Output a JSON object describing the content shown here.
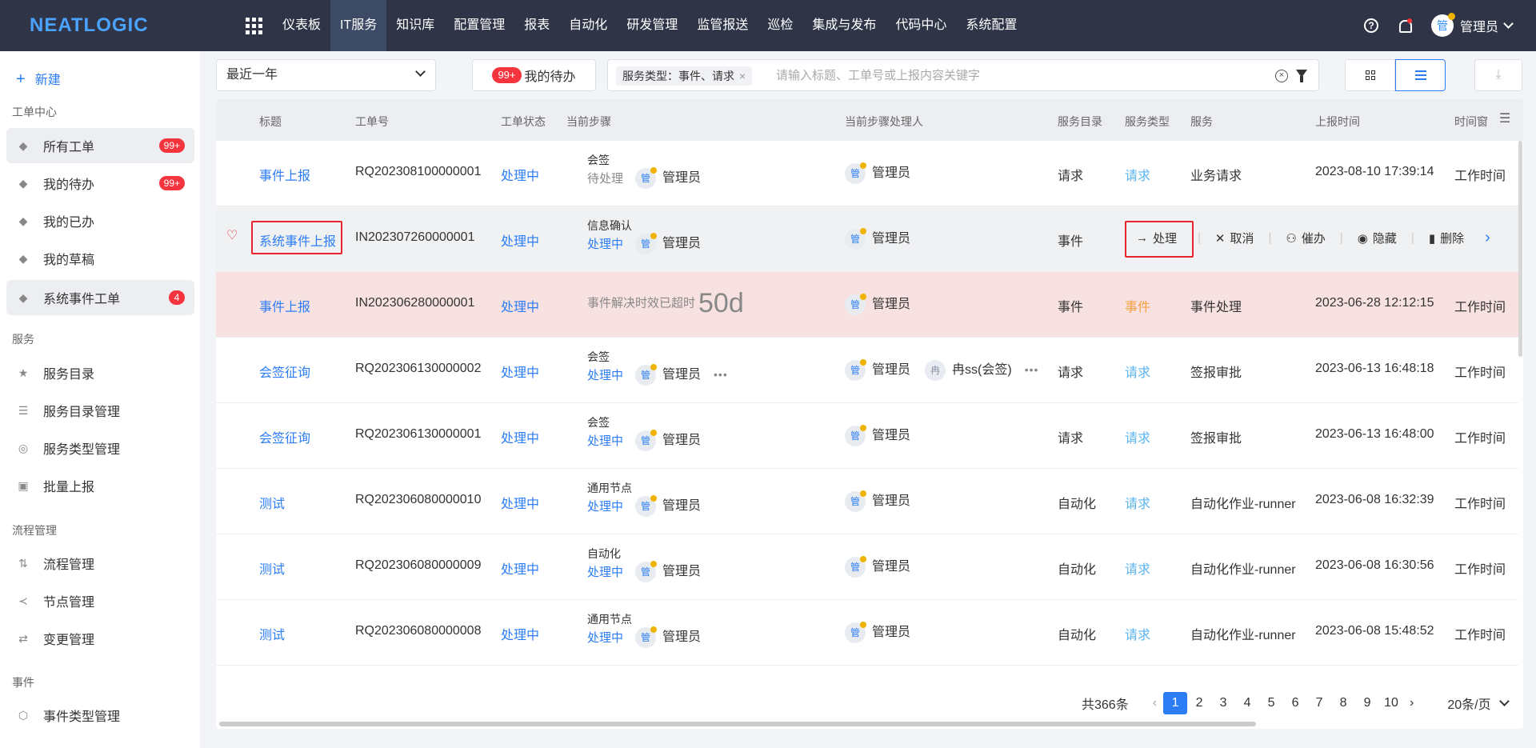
{
  "topbar": {
    "logo": "NEATLOGIC",
    "nav": [
      "仪表板",
      "IT服务",
      "知识库",
      "配置管理",
      "报表",
      "自动化",
      "研发管理",
      "监管报送",
      "巡检",
      "集成与发布",
      "代码中心",
      "系统配置"
    ],
    "active_nav": "IT服务",
    "help_glyph": "?",
    "user_avatar": "管",
    "user_name": "管理员"
  },
  "sidebar": {
    "new_label": "新建",
    "new_glyph": "+",
    "sections": [
      "工单中心",
      "服务",
      "流程管理",
      "事件"
    ],
    "workorder_items": [
      {
        "label": "所有工单",
        "badge": "99+"
      },
      {
        "label": "我的待办",
        "badge": "99+"
      },
      {
        "label": "我的已办"
      },
      {
        "label": "我的草稿"
      },
      {
        "label": "系统事件工单",
        "badge": "4"
      }
    ],
    "service_items": [
      "服务目录",
      "服务目录管理",
      "服务类型管理",
      "批量上报"
    ],
    "process_items": [
      "流程管理",
      "节点管理",
      "变更管理"
    ],
    "event_items": [
      "事件类型管理"
    ],
    "icon_glyphs": {
      "tag": "◆",
      "star": "★",
      "list": "☰",
      "type": "◎",
      "batch": "▣",
      "flow": "⇅",
      "node": "≺",
      "change": "⇄",
      "event": "⬡"
    }
  },
  "filters": {
    "range": "最近一年",
    "todo_badge": "99+",
    "todo_label": "我的待办",
    "tag_label": "服务类型：事件、请求",
    "tag_close": "×",
    "clear_glyph": "×",
    "search_placeholder": "请输入标题、工单号或上报内容关键字",
    "download_glyph": "⤓"
  },
  "table": {
    "columns": [
      "标题",
      "工单号",
      "工单状态",
      "当前步骤",
      "当前步骤处理人",
      "服务目录",
      "服务类型",
      "服务",
      "上报时间",
      "时间窗"
    ],
    "columns_glyph": "☰",
    "rows": [
      {
        "title": "事件上报",
        "no": "RQ202308100000001",
        "status": "处理中",
        "step_name": "会签",
        "step_status": "待处理",
        "step_avatar": "管",
        "step_user": "管理员",
        "handler_avatar": "管",
        "handler": "管理员",
        "catalog": "请求",
        "type": "请求",
        "service": "业务请求",
        "time": "2023-08-10 17:39:14",
        "window": "工作时间"
      },
      {
        "title": "系统事件上报",
        "no": "IN202307260000001",
        "status": "处理中",
        "step_name": "信息确认",
        "step_status": "处理中",
        "step_avatar": "管",
        "step_user": "管理员",
        "handler_avatar": "管",
        "handler": "管理员",
        "catalog": "事件"
      },
      {
        "title": "事件上报",
        "no": "IN202306280000001",
        "status": "处理中",
        "overtime_text": "事件解决时效已超时",
        "overtime_value": "50d",
        "handler_avatar": "管",
        "handler": "管理员",
        "catalog": "事件",
        "type": "事件",
        "service": "事件处理",
        "time": "2023-06-28 12:12:15",
        "window": "工作时间"
      },
      {
        "title": "会签征询",
        "no": "RQ202306130000002",
        "status": "处理中",
        "step_name": "会签",
        "step_status": "处理中",
        "step_avatar": "管",
        "step_user": "管理员",
        "more": "•••",
        "handler_avatar": "管",
        "handler": "管理员",
        "handler2_avatar": "冉",
        "handler2": "冉ss(会签)",
        "handler_more": "•••",
        "catalog": "请求",
        "type": "请求",
        "service": "签报审批",
        "time": "2023-06-13 16:48:18",
        "window": "工作时间"
      },
      {
        "title": "会签征询",
        "no": "RQ202306130000001",
        "status": "处理中",
        "step_name": "会签",
        "step_status": "处理中",
        "step_avatar": "管",
        "step_user": "管理员",
        "handler_avatar": "管",
        "handler": "管理员",
        "catalog": "请求",
        "type": "请求",
        "service": "签报审批",
        "time": "2023-06-13 16:48:00",
        "window": "工作时间"
      },
      {
        "title": "测试",
        "no": "RQ202306080000010",
        "status": "处理中",
        "step_name": "通用节点",
        "step_status": "处理中",
        "step_avatar": "管",
        "step_user": "管理员",
        "handler_avatar": "管",
        "handler": "管理员",
        "catalog": "自动化",
        "type": "请求",
        "service": "自动化作业-runner",
        "time": "2023-06-08 16:32:39",
        "window": "工作时间"
      },
      {
        "title": "测试",
        "no": "RQ202306080000009",
        "status": "处理中",
        "step_name": "自动化",
        "step_status": "处理中",
        "step_avatar": "管",
        "step_user": "管理员",
        "handler_avatar": "管",
        "handler": "管理员",
        "catalog": "自动化",
        "type": "请求",
        "service": "自动化作业-runner",
        "time": "2023-06-08 16:30:56",
        "window": "工作时间"
      },
      {
        "title": "测试",
        "no": "RQ202306080000008",
        "status": "处理中",
        "step_name": "通用节点",
        "step_status": "处理中",
        "step_avatar": "管",
        "step_user": "管理员",
        "handler_avatar": "管",
        "handler": "管理员",
        "catalog": "自动化",
        "type": "请求",
        "service": "自动化作业-runner",
        "time": "2023-06-08 15:48:52",
        "window": "工作时间"
      }
    ],
    "row_actions": {
      "heart": "♡",
      "process": "处理",
      "process_glyph": "→",
      "cancel": "取消",
      "cancel_glyph": "✕",
      "urge": "催办",
      "urge_glyph": "⚇",
      "hide": "隐藏",
      "hide_glyph": "◉",
      "delete": "删除",
      "delete_glyph": "▮",
      "next_glyph": "›"
    }
  },
  "pagination": {
    "total": "共366条",
    "prev": "‹",
    "next": "›",
    "pages": [
      "1",
      "2",
      "3",
      "4",
      "5",
      "6",
      "7",
      "8",
      "9",
      "10"
    ],
    "current": "1",
    "page_size": "20条/页"
  },
  "colors": {
    "primary": "#2c7df5",
    "topbar": "#2f3547",
    "overdue_row": "#f8e2e1",
    "highlight_box": "#e5262c",
    "badge": "#f5343d"
  }
}
